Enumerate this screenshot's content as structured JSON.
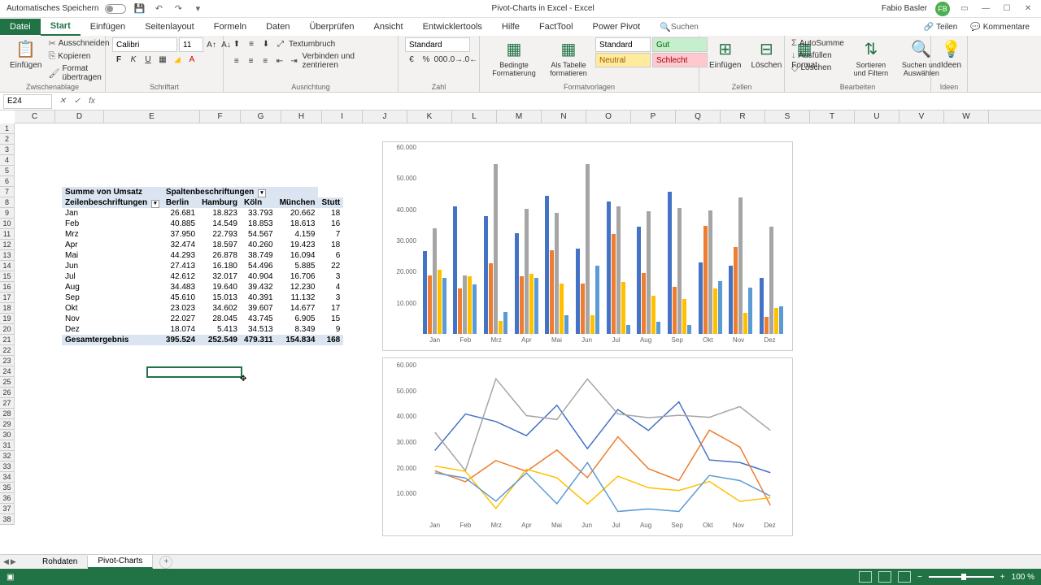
{
  "titlebar": {
    "auto_save": "Automatisches Speichern",
    "title": "Pivot-Charts in Excel - Excel",
    "user": "Fabio Basler",
    "user_initials": "FB"
  },
  "tabs": {
    "file": "Datei",
    "start": "Start",
    "insert": "Einfügen",
    "page_layout": "Seitenlayout",
    "formulas": "Formeln",
    "data": "Daten",
    "review": "Überprüfen",
    "view": "Ansicht",
    "developer": "Entwicklertools",
    "help": "Hilfe",
    "facttool": "FactTool",
    "powerpivot": "Power Pivot",
    "search": "Suchen",
    "share": "Teilen",
    "comments": "Kommentare"
  },
  "ribbon": {
    "paste": "Einfügen",
    "cut": "Ausschneiden",
    "copy": "Kopieren",
    "format_painter": "Format übertragen",
    "clipboard": "Zwischenablage",
    "font_name": "Calibri",
    "font_size": "11",
    "font_group": "Schriftart",
    "wrap": "Textumbruch",
    "merge": "Verbinden und zentrieren",
    "alignment": "Ausrichtung",
    "number_format": "Standard",
    "number": "Zahl",
    "cond_fmt": "Bedingte Formatierung",
    "as_table": "Als Tabelle formatieren",
    "standard": "Standard",
    "gut": "Gut",
    "neutral": "Neutral",
    "schlecht": "Schlecht",
    "styles": "Formatvorlagen",
    "insert_cells": "Einfügen",
    "delete_cells": "Löschen",
    "format_cells": "Format",
    "cells": "Zellen",
    "autosum": "AutoSumme",
    "fill": "Ausfüllen",
    "clear": "Löschen",
    "sort_filter": "Sortieren und Filtern",
    "find_select": "Suchen und Auswählen",
    "editing": "Bearbeiten",
    "ideas": "Ideen",
    "ideas_group": "Ideen"
  },
  "formula_bar": {
    "name_box": "E24",
    "formula": ""
  },
  "columns": [
    "C",
    "D",
    "E",
    "F",
    "G",
    "H",
    "I",
    "J",
    "K",
    "L",
    "M",
    "N",
    "O",
    "P",
    "Q",
    "R",
    "S",
    "T",
    "U",
    "V",
    "W"
  ],
  "pivot": {
    "sum_of": "Summe von Umsatz",
    "col_labels": "Spaltenbeschriftungen",
    "row_labels": "Zeilenbeschriftungen",
    "cities": [
      "Berlin",
      "Hamburg",
      "Köln",
      "München",
      "Stutt"
    ],
    "months": [
      "Jan",
      "Feb",
      "Mrz",
      "Apr",
      "Mai",
      "Jun",
      "Jul",
      "Aug",
      "Sep",
      "Okt",
      "Nov",
      "Dez"
    ],
    "total_label": "Gesamtergebnis",
    "data": [
      [
        "26.681",
        "18.823",
        "33.793",
        "20.662",
        "18"
      ],
      [
        "40.885",
        "14.549",
        "18.853",
        "18.613",
        "16"
      ],
      [
        "37.950",
        "22.793",
        "54.567",
        "4.159",
        "7"
      ],
      [
        "32.474",
        "18.597",
        "40.260",
        "19.423",
        "18"
      ],
      [
        "44.293",
        "26.878",
        "38.749",
        "16.094",
        "6"
      ],
      [
        "27.413",
        "16.180",
        "54.496",
        "5.885",
        "22"
      ],
      [
        "42.612",
        "32.017",
        "40.904",
        "16.706",
        "3"
      ],
      [
        "34.483",
        "19.640",
        "39.432",
        "12.230",
        "4"
      ],
      [
        "45.610",
        "15.013",
        "40.391",
        "11.132",
        "3"
      ],
      [
        "23.023",
        "34.602",
        "39.607",
        "14.677",
        "17"
      ],
      [
        "22.027",
        "28.045",
        "43.745",
        "6.905",
        "15"
      ],
      [
        "18.074",
        "5.413",
        "34.513",
        "8.349",
        "9"
      ]
    ],
    "totals": [
      "395.524",
      "252.549",
      "479.311",
      "154.834",
      "168"
    ]
  },
  "sheet_tabs": {
    "tab1": "Rohdaten",
    "tab2": "Pivot-Charts"
  },
  "statusbar": {
    "zoom": "100 %"
  },
  "chart_data": [
    {
      "type": "bar",
      "categories": [
        "Jan",
        "Feb",
        "Mrz",
        "Apr",
        "Mai",
        "Jun",
        "Jul",
        "Aug",
        "Sep",
        "Okt",
        "Nov",
        "Dez"
      ],
      "series": [
        {
          "name": "Berlin",
          "color": "#4472c4",
          "values": [
            26681,
            40885,
            37950,
            32474,
            44293,
            27413,
            42612,
            34483,
            45610,
            23023,
            22027,
            18074
          ]
        },
        {
          "name": "Hamburg",
          "color": "#ed7d31",
          "values": [
            18823,
            14549,
            22793,
            18597,
            26878,
            16180,
            32017,
            19640,
            15013,
            34602,
            28045,
            5413
          ]
        },
        {
          "name": "Köln",
          "color": "#a5a5a5",
          "values": [
            33793,
            18853,
            54567,
            40260,
            38749,
            54496,
            40904,
            39432,
            40391,
            39607,
            43745,
            34513
          ]
        },
        {
          "name": "München",
          "color": "#ffc000",
          "values": [
            20662,
            18613,
            4159,
            19423,
            16094,
            5885,
            16706,
            12230,
            11132,
            14677,
            6905,
            8349
          ]
        },
        {
          "name": "Stuttgart",
          "color": "#5b9bd5",
          "values": [
            18000,
            16000,
            7000,
            18000,
            6000,
            22000,
            3000,
            4000,
            3000,
            17000,
            15000,
            9000
          ]
        }
      ],
      "ylim": [
        0,
        60000
      ],
      "yticks": [
        10000,
        20000,
        30000,
        40000,
        50000,
        60000
      ],
      "ytick_labels": [
        "10.000",
        "20.000",
        "30.000",
        "40.000",
        "50.000",
        "60.000"
      ]
    },
    {
      "type": "line",
      "categories": [
        "Jan",
        "Feb",
        "Mrz",
        "Apr",
        "Mai",
        "Jun",
        "Jul",
        "Aug",
        "Sep",
        "Okt",
        "Nov",
        "Dez"
      ],
      "series": [
        {
          "name": "Berlin",
          "color": "#4472c4",
          "values": [
            26681,
            40885,
            37950,
            32474,
            44293,
            27413,
            42612,
            34483,
            45610,
            23023,
            22027,
            18074
          ]
        },
        {
          "name": "Hamburg",
          "color": "#ed7d31",
          "values": [
            18823,
            14549,
            22793,
            18597,
            26878,
            16180,
            32017,
            19640,
            15013,
            34602,
            28045,
            5413
          ]
        },
        {
          "name": "Köln",
          "color": "#a5a5a5",
          "values": [
            33793,
            18853,
            54567,
            40260,
            38749,
            54496,
            40904,
            39432,
            40391,
            39607,
            43745,
            34513
          ]
        },
        {
          "name": "München",
          "color": "#ffc000",
          "values": [
            20662,
            18613,
            4159,
            19423,
            16094,
            5885,
            16706,
            12230,
            11132,
            14677,
            6905,
            8349
          ]
        },
        {
          "name": "Stuttgart",
          "color": "#5b9bd5",
          "values": [
            18000,
            16000,
            7000,
            18000,
            6000,
            22000,
            3000,
            4000,
            3000,
            17000,
            15000,
            9000
          ]
        }
      ],
      "ylim": [
        0,
        60000
      ],
      "yticks": [
        10000,
        20000,
        30000,
        40000,
        50000,
        60000
      ],
      "ytick_labels": [
        "10.000",
        "20.000",
        "30.000",
        "40.000",
        "50.000",
        "60.000"
      ]
    }
  ]
}
